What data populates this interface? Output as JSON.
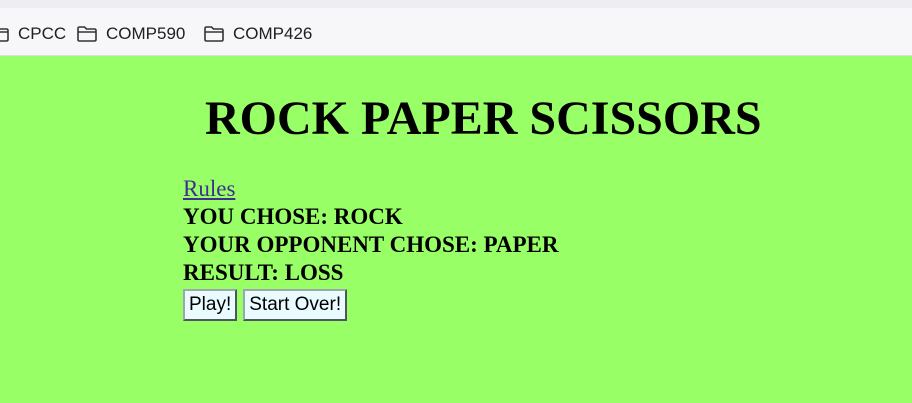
{
  "bookmarks_bar": {
    "items": [
      {
        "label": "CPCC",
        "icon": "folder-icon"
      },
      {
        "label": "COMP590",
        "icon": "folder-icon"
      },
      {
        "label": "COMP426",
        "icon": "folder-icon"
      }
    ]
  },
  "page": {
    "title": "ROCK PAPER SCISSORS",
    "rules_link": "Rules",
    "you_chose": "YOU CHOSE: ROCK",
    "opponent_chose": "YOUR OPPONENT CHOSE: PAPER",
    "result": "RESULT: LOSS",
    "play_button": "Play!",
    "start_over_button": "Start Over!"
  },
  "colors": {
    "page_background": "#99ff66",
    "bookmarks_bar_background": "#f7f7fa",
    "link": "#3f2f8f",
    "button_background": "#e9fbff"
  }
}
